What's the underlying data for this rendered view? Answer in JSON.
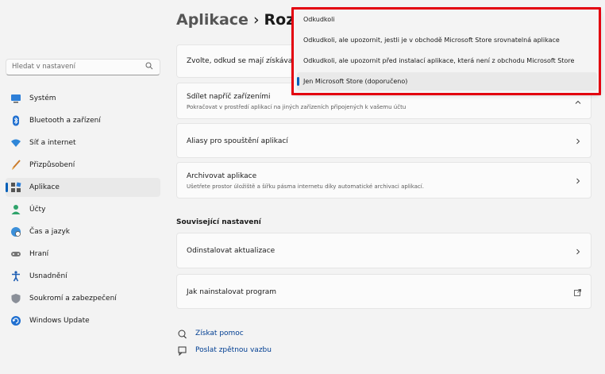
{
  "search": {
    "placeholder": "Hledat v nastavení"
  },
  "sidebar": {
    "items": [
      {
        "label": "Systém",
        "icon": "monitor-icon"
      },
      {
        "label": "Bluetooth a zařízení",
        "icon": "bluetooth-icon"
      },
      {
        "label": "Síť a internet",
        "icon": "wifi-icon"
      },
      {
        "label": "Přizpůsobení",
        "icon": "brush-icon"
      },
      {
        "label": "Aplikace",
        "icon": "apps-icon",
        "active": true
      },
      {
        "label": "Účty",
        "icon": "person-icon"
      },
      {
        "label": "Čas a jazyk",
        "icon": "globe-clock-icon"
      },
      {
        "label": "Hraní",
        "icon": "gamepad-icon"
      },
      {
        "label": "Usnadnění",
        "icon": "accessibility-icon"
      },
      {
        "label": "Soukromí a zabezpečení",
        "icon": "shield-icon"
      },
      {
        "label": "Windows Update",
        "icon": "update-icon"
      }
    ]
  },
  "header": {
    "parent": "Aplikace",
    "separator": "›",
    "current": "Rozš"
  },
  "main": {
    "source_row": {
      "label": "Zvolte, odkud se mají získávat"
    },
    "share_row": {
      "title": "Sdílet napříč zařízeními",
      "subtitle": "Pokračovat v prostředí aplikací na jiných zařízeních připojených k vašemu účtu"
    },
    "aliases_row": {
      "title": "Aliasy pro spouštění aplikací"
    },
    "archive_row": {
      "title": "Archivovat aplikace",
      "subtitle": "Ušetřete prostor úložiště a šířku pásma internetu díky automatické archivaci aplikací."
    },
    "related_title": "Související nastavení",
    "uninstall_updates": {
      "title": "Odinstalovat aktualizace"
    },
    "install_program": {
      "title": "Jak nainstalovat program"
    }
  },
  "links": {
    "help": "Získat pomoc",
    "feedback": "Poslat zpětnou vazbu"
  },
  "dropdown": {
    "options": [
      "Odkudkoli",
      "Odkudkoli, ale upozornit, jestli je v obchodě Microsoft Store srovnatelná aplikace",
      "Odkudkoli, ale upozornit před instalací aplikace, která není z obchodu Microsoft Store",
      "Jen Microsoft Store (doporučeno)"
    ],
    "selected_index": 3
  },
  "colors": {
    "accent": "#005fb8",
    "highlight_frame": "#e3000f",
    "link": "#003e92"
  }
}
